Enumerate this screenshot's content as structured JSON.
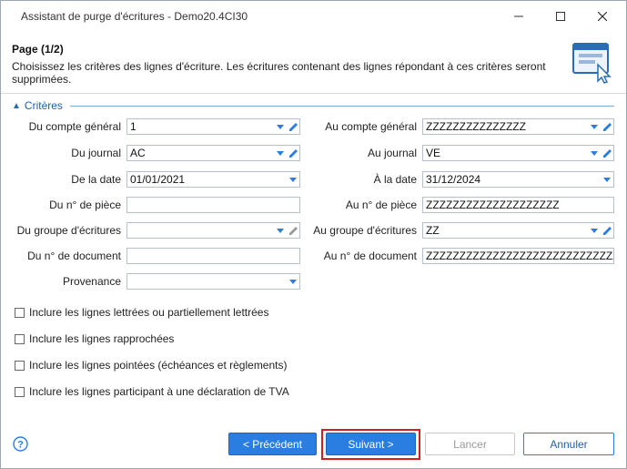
{
  "window": {
    "title": "Assistant de purge d'écritures - Demo20.4CI30"
  },
  "titlebar_buttons": {
    "minimize": "minimize-icon",
    "maximize": "maximize-icon",
    "close": "close-icon"
  },
  "header": {
    "page_title": "Page (1/2)",
    "description": "Choisissez les critères des lignes d'écriture. Les écritures contenant des lignes répondant à ces critères seront supprimées."
  },
  "section": {
    "label": "Critères"
  },
  "left_fields": [
    {
      "label": "Du compte général",
      "value": "1",
      "kind": "combo-edit"
    },
    {
      "label": "Du journal",
      "value": "AC",
      "kind": "combo-edit"
    },
    {
      "label": "De la date",
      "value": "01/01/2021",
      "kind": "combo"
    },
    {
      "label": "Du n° de pièce",
      "value": "",
      "kind": "text"
    },
    {
      "label": "Du groupe d'écritures",
      "value": "",
      "kind": "combo-edit-disabled"
    },
    {
      "label": "Du n° de document",
      "value": "",
      "kind": "text"
    },
    {
      "label": "Provenance",
      "value": "",
      "kind": "combo"
    }
  ],
  "right_fields": [
    {
      "label": "Au compte général",
      "value": "ZZZZZZZZZZZZZZZ",
      "kind": "combo-edit"
    },
    {
      "label": "Au journal",
      "value": "VE",
      "kind": "combo-edit"
    },
    {
      "label": "À la date",
      "value": "31/12/2024",
      "kind": "combo"
    },
    {
      "label": "Au n° de pièce",
      "value": "ZZZZZZZZZZZZZZZZZZZZ",
      "kind": "text"
    },
    {
      "label": "Au groupe d'écritures",
      "value": "ZZ",
      "kind": "combo-edit"
    },
    {
      "label": "Au n° de document",
      "value": "ZZZZZZZZZZZZZZZZZZZZZZZZZZZZZZZZZZZ",
      "kind": "text"
    }
  ],
  "checkboxes": [
    {
      "label": "Inclure les lignes lettrées ou partiellement lettrées",
      "checked": false
    },
    {
      "label": "Inclure les lignes rapprochées",
      "checked": false
    },
    {
      "label": "Inclure les lignes pointées (échéances et règlements)",
      "checked": false
    },
    {
      "label": "Inclure les lignes participant à une déclaration de TVA",
      "checked": false
    }
  ],
  "buttons": {
    "previous": "< Précédent",
    "next": "Suivant >",
    "cancel": "Lancer",
    "abort": "Annuler"
  },
  "colors": {
    "accent": "#2a7de1",
    "focus": "#d21f1f",
    "section": "#1f5fa8"
  }
}
